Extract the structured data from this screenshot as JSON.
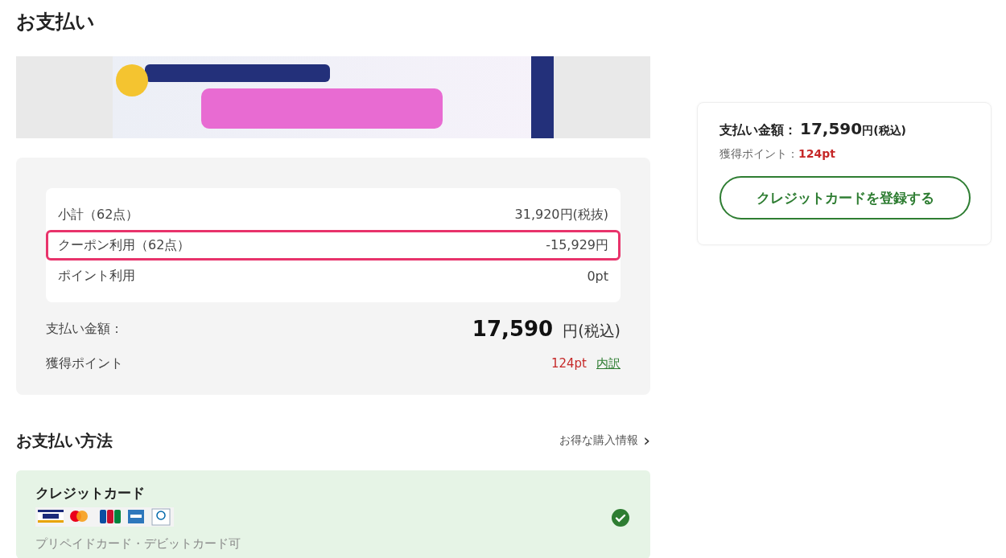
{
  "page_title": "お支払い",
  "summary": {
    "lines": [
      {
        "label": "小計（62点）",
        "value": "31,920円(税抜)",
        "highlighted": false
      },
      {
        "label": "クーポン利用（62点）",
        "value": "-15,929円",
        "highlighted": true
      },
      {
        "label": "ポイント利用",
        "value": "0pt",
        "highlighted": false
      }
    ],
    "total_label": "支払い金額：",
    "total_amount": "17,590",
    "total_unit": "円(税込)",
    "points_label": "獲得ポイント",
    "points_value": "124pt",
    "points_link": "内訳"
  },
  "payment": {
    "title": "お支払い方法",
    "info_link": "お得な購入情報",
    "chevron": "›",
    "methods": [
      {
        "name": "クレジットカード",
        "note": "プリペイドカード・デビットカード可",
        "selected": true
      }
    ]
  },
  "side": {
    "total_label": "支払い金額：",
    "total_amount": "17,590",
    "total_unit": "円(税込)",
    "points_label": "獲得ポイント：",
    "points_value": "124pt",
    "button": "クレジットカードを登録する"
  }
}
